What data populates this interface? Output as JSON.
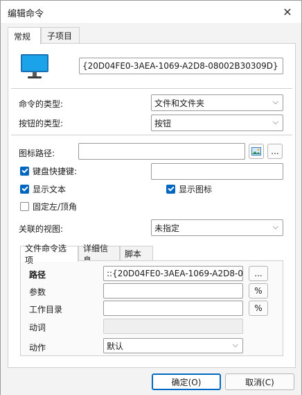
{
  "window": {
    "title": "编辑命令",
    "close_glyph": "✕"
  },
  "tabs": [
    {
      "label": "常规"
    },
    {
      "label": "子项目"
    }
  ],
  "general": {
    "command_id": "{20D04FE0-3AEA-1069-A2D8-08002B30309D}",
    "command_type_label": "命令的类型:",
    "command_type_value": "文件和文件夹",
    "button_type_label": "按钮的类型:",
    "button_type_value": "按钮",
    "icon_path_label": "图标路径:",
    "icon_path_value": "",
    "browse_label": "...",
    "hotkey_label": "键盘快捷键:",
    "hotkey_value": "",
    "show_text_label": "显示文本",
    "show_icon_label": "显示图标",
    "fixed_label": "固定左/顶角",
    "view_label": "关联的视图:",
    "view_value": "未指定"
  },
  "inner_tabs": [
    {
      "label": "文件命令选项"
    },
    {
      "label": "详细信息"
    },
    {
      "label": "脚本"
    }
  ],
  "file_options": {
    "path_label": "路径",
    "path_value": "::{20D04FE0-3AEA-1069-A2D8-08002B30309D}",
    "path_btn": "...",
    "params_label": "参数",
    "params_value": "",
    "params_btn": "%",
    "workdir_label": "工作目录",
    "workdir_value": "",
    "workdir_btn": "%",
    "verb_label": "动词",
    "verb_value": "",
    "action_label": "动作",
    "action_value": "默认"
  },
  "footer": {
    "ok_label": "确定(O)",
    "cancel_label": "取消(C)"
  },
  "colors": {
    "accent": "#0067c0",
    "monitor_screen": "#1aa3e8"
  }
}
